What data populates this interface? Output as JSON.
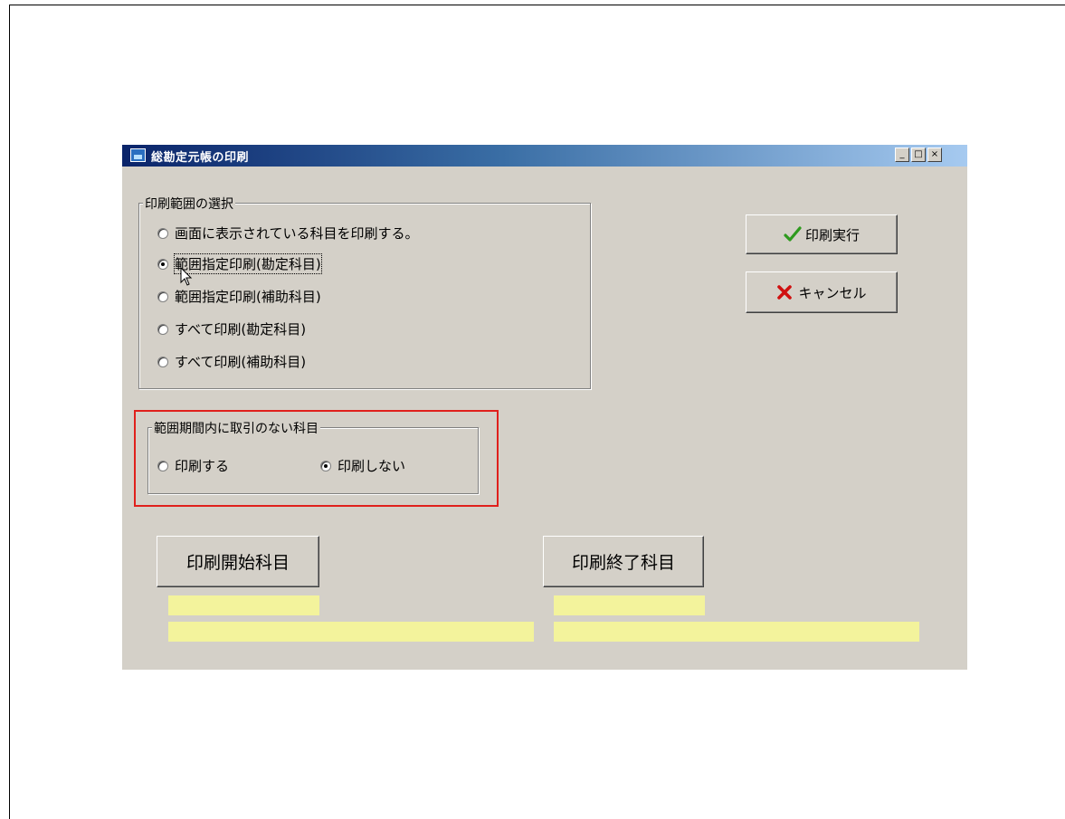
{
  "window": {
    "title": "総勘定元帳の印刷",
    "caption_buttons": {
      "minimize": "_",
      "maximize": "□",
      "close": "×"
    }
  },
  "print_range_group": {
    "legend": "印刷範囲の選択",
    "options": [
      {
        "label": "画面に表示されている科目を印刷する。",
        "checked": false
      },
      {
        "label": "範囲指定印刷(勘定科目)",
        "checked": true
      },
      {
        "label": "範囲指定印刷(補助科目)",
        "checked": false
      },
      {
        "label": "すべて印刷(勘定科目)",
        "checked": false
      },
      {
        "label": "すべて印刷(補助科目)",
        "checked": false
      }
    ]
  },
  "no_transaction_group": {
    "legend": "範囲期間内に取引のない科目",
    "options": [
      {
        "label": "印刷する",
        "checked": false
      },
      {
        "label": "印刷しない",
        "checked": true
      }
    ]
  },
  "buttons": {
    "execute": {
      "label": "印刷実行",
      "icon": "checkmark-icon",
      "icon_color": "#2e9a1e"
    },
    "cancel": {
      "label": "キャンセル",
      "icon": "x-mark-icon",
      "icon_color": "#d01010"
    },
    "start_subject": {
      "label": "印刷開始科目"
    },
    "end_subject": {
      "label": "印刷終了科目"
    }
  },
  "fields": {
    "start_code": "",
    "start_name": "",
    "end_code": "",
    "end_name": ""
  },
  "colors": {
    "window_bg": "#d4d0c8",
    "titlebar_start": "#0a246a",
    "titlebar_end": "#a6caf0",
    "field_bg": "#f3f39c",
    "highlight": "#e0201c"
  }
}
